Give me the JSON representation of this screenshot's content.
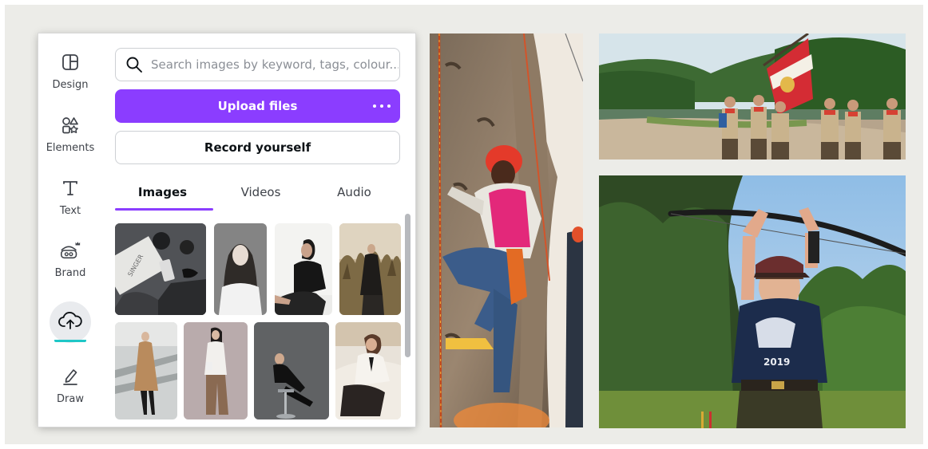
{
  "rail": {
    "items": [
      {
        "label": "Design",
        "icon": "layout-icon"
      },
      {
        "label": "Elements",
        "icon": "shapes-icon"
      },
      {
        "label": "Text",
        "icon": "text-t-icon"
      },
      {
        "label": "Brand",
        "icon": "brand-crown-icon"
      },
      {
        "label": "",
        "icon": "cloud-upload-icon"
      },
      {
        "label": "Draw",
        "icon": "pen-icon"
      }
    ]
  },
  "search": {
    "placeholder": "Search images by keyword, tags, colour..."
  },
  "buttons": {
    "upload_label": "Upload files",
    "record_label": "Record yourself"
  },
  "tabs": [
    {
      "label": "Images",
      "active": true
    },
    {
      "label": "Videos",
      "active": false
    },
    {
      "label": "Audio",
      "active": false
    }
  ],
  "colors": {
    "brand_purple": "#8b3dff",
    "active_teal": "#1fc7c7",
    "frame_bg": "#ecece8"
  },
  "gallery": {
    "count": 8
  },
  "photos": [
    {
      "subject": "rock-climbing-wall"
    },
    {
      "subject": "scouts-with-flag"
    },
    {
      "subject": "archery-bow"
    }
  ]
}
